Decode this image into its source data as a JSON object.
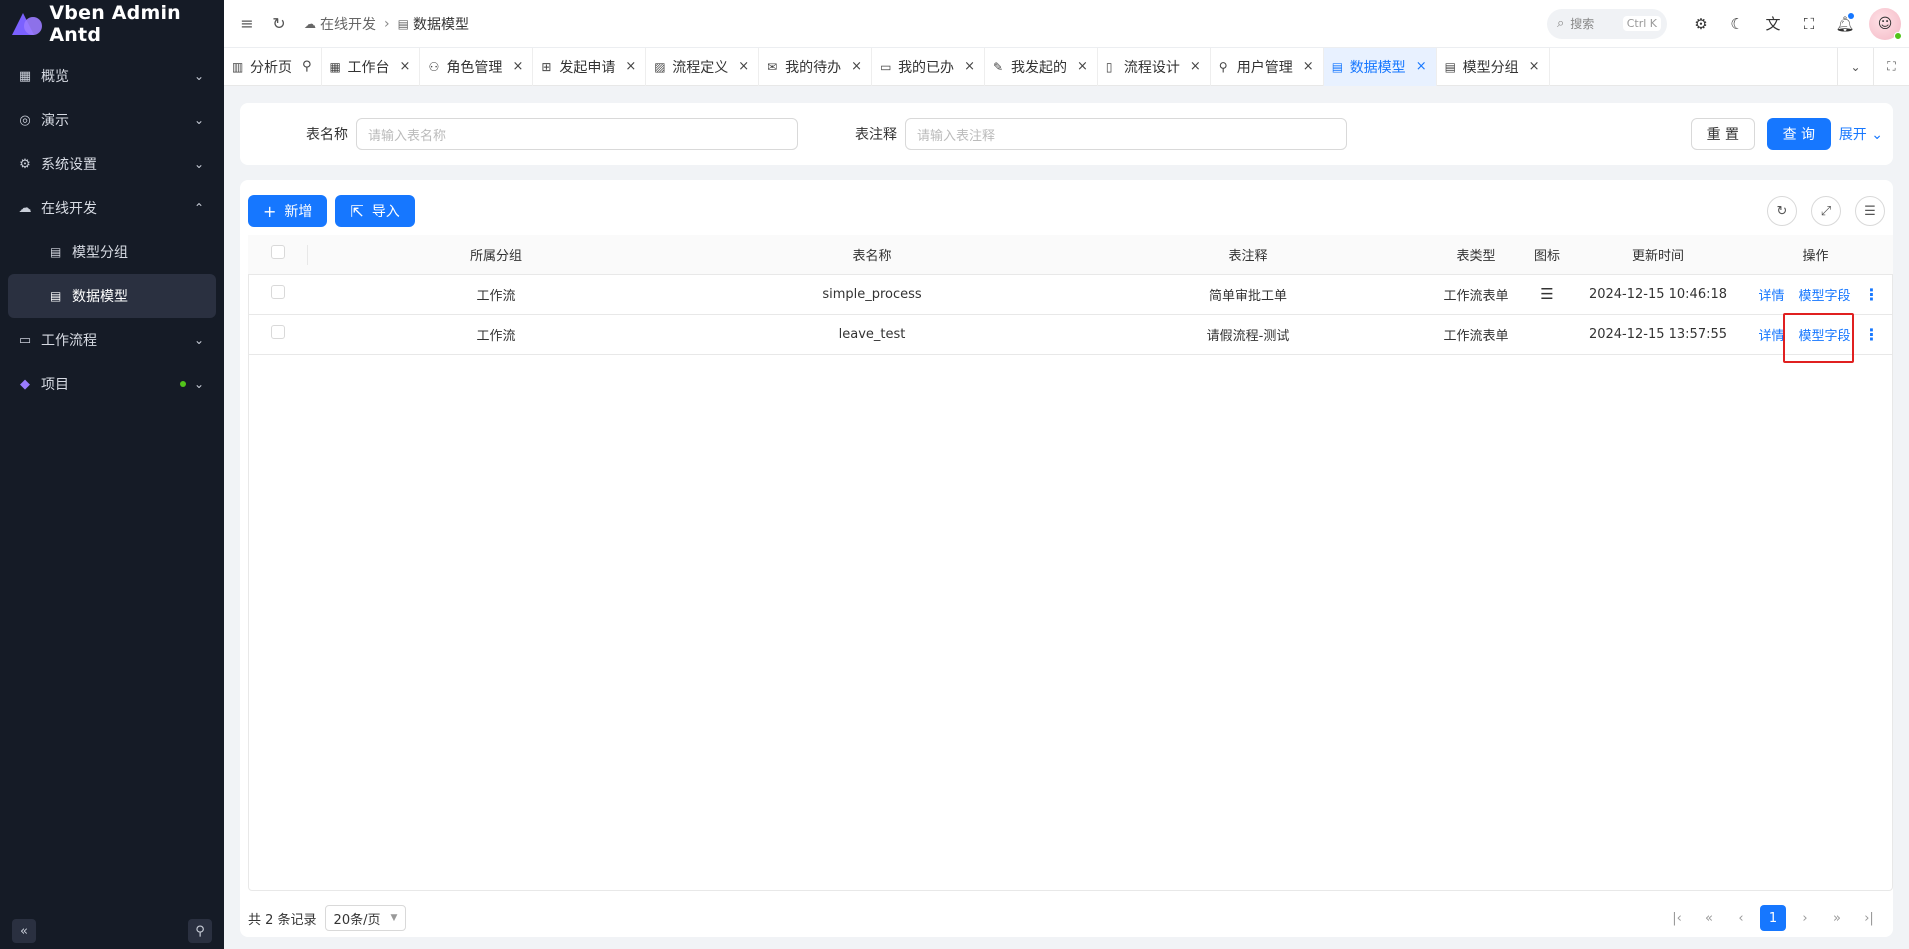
{
  "app": {
    "title": "Vben Admin Antd"
  },
  "sidebar": {
    "items": [
      {
        "label": "概览",
        "icon": "grid-icon"
      },
      {
        "label": "演示",
        "icon": "demo-icon"
      },
      {
        "label": "系统设置",
        "icon": "gear-icon"
      },
      {
        "label": "在线开发",
        "icon": "cloud-icon",
        "expanded": true,
        "children": [
          {
            "label": "模型分组",
            "icon": "doc-icon"
          },
          {
            "label": "数据模型",
            "icon": "doc-icon",
            "active": true
          }
        ]
      },
      {
        "label": "工作流程",
        "icon": "monitor-icon"
      },
      {
        "label": "项目",
        "icon": "vben-logo-icon"
      }
    ]
  },
  "header": {
    "breadcrumb": [
      "在线开发",
      "数据模型"
    ],
    "search_placeholder": "搜索",
    "search_shortcut": "Ctrl K"
  },
  "tabs": [
    {
      "label": "分析页",
      "icon": "chart-icon",
      "pinned": true
    },
    {
      "label": "工作台",
      "icon": "workbench-icon"
    },
    {
      "label": "角色管理",
      "icon": "role-icon"
    },
    {
      "label": "发起申请",
      "icon": "apps-icon"
    },
    {
      "label": "流程定义",
      "icon": "image-icon"
    },
    {
      "label": "我的待办",
      "icon": "mail-icon"
    },
    {
      "label": "我的已办",
      "icon": "book-icon"
    },
    {
      "label": "我发起的",
      "icon": "edit-icon"
    },
    {
      "label": "流程设计",
      "icon": "file-icon"
    },
    {
      "label": "用户管理",
      "icon": "user-icon"
    },
    {
      "label": "数据模型",
      "icon": "doc-icon",
      "active": true
    },
    {
      "label": "模型分组",
      "icon": "doc-icon"
    }
  ],
  "query": {
    "table_name_label": "表名称",
    "table_name_placeholder": "请输入表名称",
    "table_comment_label": "表注释",
    "table_comment_placeholder": "请输入表注释",
    "reset_label": "重 置",
    "search_label": "查 询",
    "expand_label": "展开"
  },
  "toolbar": {
    "add_label": "新增",
    "import_label": "导入"
  },
  "table": {
    "columns": [
      "所属分组",
      "表名称",
      "表注释",
      "表类型",
      "图标",
      "更新时间",
      "操作"
    ],
    "rows": [
      {
        "group": "工作流",
        "name": "simple_process",
        "comment": "简单审批工单",
        "type": "工作流表单",
        "icon": "menu-lines-icon",
        "updated": "2024-12-15 10:46:18",
        "detail": "详情",
        "fields": "模型字段"
      },
      {
        "group": "工作流",
        "name": "leave_test",
        "comment": "请假流程-测试",
        "type": "工作流表单",
        "icon": "",
        "updated": "2024-12-15 13:57:55",
        "detail": "详情",
        "fields": "模型字段"
      }
    ]
  },
  "pagination": {
    "total_text": "共 2 条记录",
    "page_size": "20条/页",
    "current_page": "1"
  },
  "colors": {
    "primary": "#1677ff",
    "sidebar_bg": "#151b26",
    "highlight": "#e02020"
  }
}
